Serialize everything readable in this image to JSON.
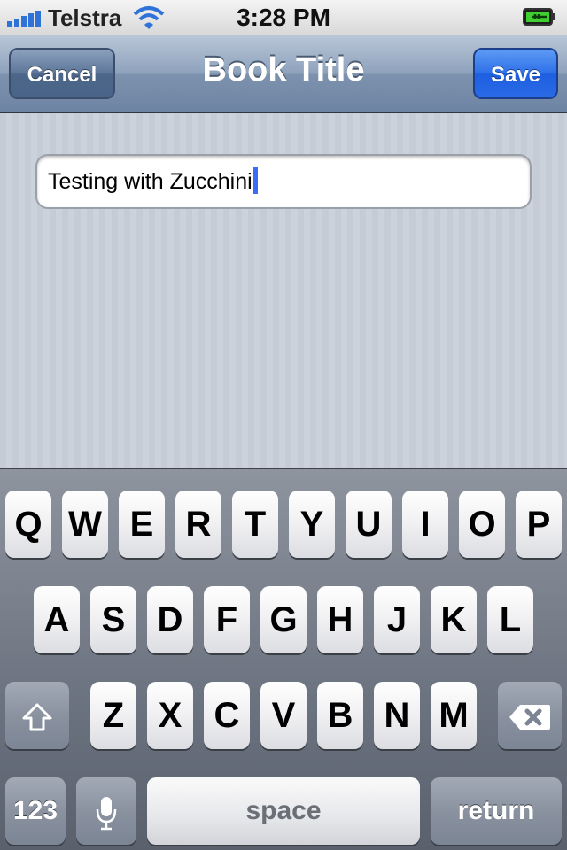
{
  "status_bar": {
    "carrier": "Telstra",
    "time": "3:28 PM",
    "signal_icon": "signal-bars-icon",
    "wifi_icon": "wifi-icon",
    "battery_icon": "battery-charging-icon"
  },
  "nav": {
    "title": "Book Title",
    "cancel_label": "Cancel",
    "save_label": "Save"
  },
  "field": {
    "value": "Testing with Zucchini"
  },
  "keyboard": {
    "row1": [
      "Q",
      "W",
      "E",
      "R",
      "T",
      "Y",
      "U",
      "I",
      "O",
      "P"
    ],
    "row2": [
      "A",
      "S",
      "D",
      "F",
      "G",
      "H",
      "J",
      "K",
      "L"
    ],
    "row3": [
      "Z",
      "X",
      "C",
      "V",
      "B",
      "N",
      "M"
    ],
    "numbers_label": "123",
    "space_label": "space",
    "return_label": "return",
    "shift_icon": "shift-arrow-icon",
    "delete_icon": "backspace-icon",
    "mic_icon": "microphone-icon"
  },
  "colors": {
    "nav_save": "#2b6ae6",
    "caret": "#3c6cf5"
  }
}
